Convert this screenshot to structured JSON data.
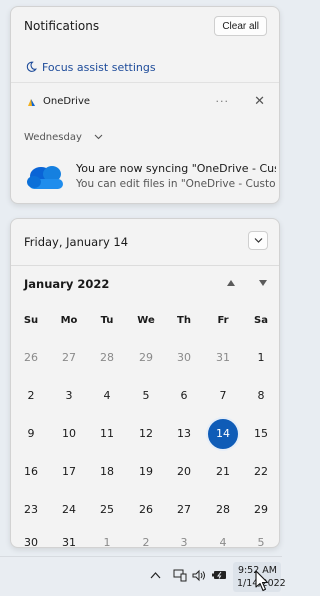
{
  "notifications": {
    "title": "Notifications",
    "clear_all_label": "Clear all",
    "focus_assist_label": "Focus assist settings",
    "focus_icon": "moon-icon",
    "app_group": {
      "app_name": "OneDrive",
      "more_label": "···",
      "close_label": "✕",
      "day_label": "Wednesday",
      "toast": {
        "title": "You are now syncing \"OneDrive - Custo",
        "body": "You can edit files in \"OneDrive - Custor"
      }
    }
  },
  "calendar": {
    "header_date": "Friday, January 14",
    "month_label": "January 2022",
    "weekdays": [
      "Su",
      "Mo",
      "Tu",
      "We",
      "Th",
      "Fr",
      "Sa"
    ],
    "days": [
      "26",
      "27",
      "28",
      "29",
      "30",
      "31",
      "1",
      "2",
      "3",
      "4",
      "5",
      "6",
      "7",
      "8",
      "9",
      "10",
      "11",
      "12",
      "13",
      "14",
      "15",
      "16",
      "17",
      "18",
      "19",
      "20",
      "21",
      "22",
      "23",
      "24",
      "25",
      "26",
      "27",
      "28",
      "29",
      "30",
      "31",
      "1",
      "2",
      "3",
      "4",
      "5"
    ],
    "selected_day": "14",
    "accent_color": "#0f5cb7"
  },
  "taskbar": {
    "time": "9:52 AM",
    "date": "1/14/2022",
    "icons": [
      "chevron-up-icon",
      "network-icon",
      "volume-icon",
      "battery-icon"
    ]
  }
}
